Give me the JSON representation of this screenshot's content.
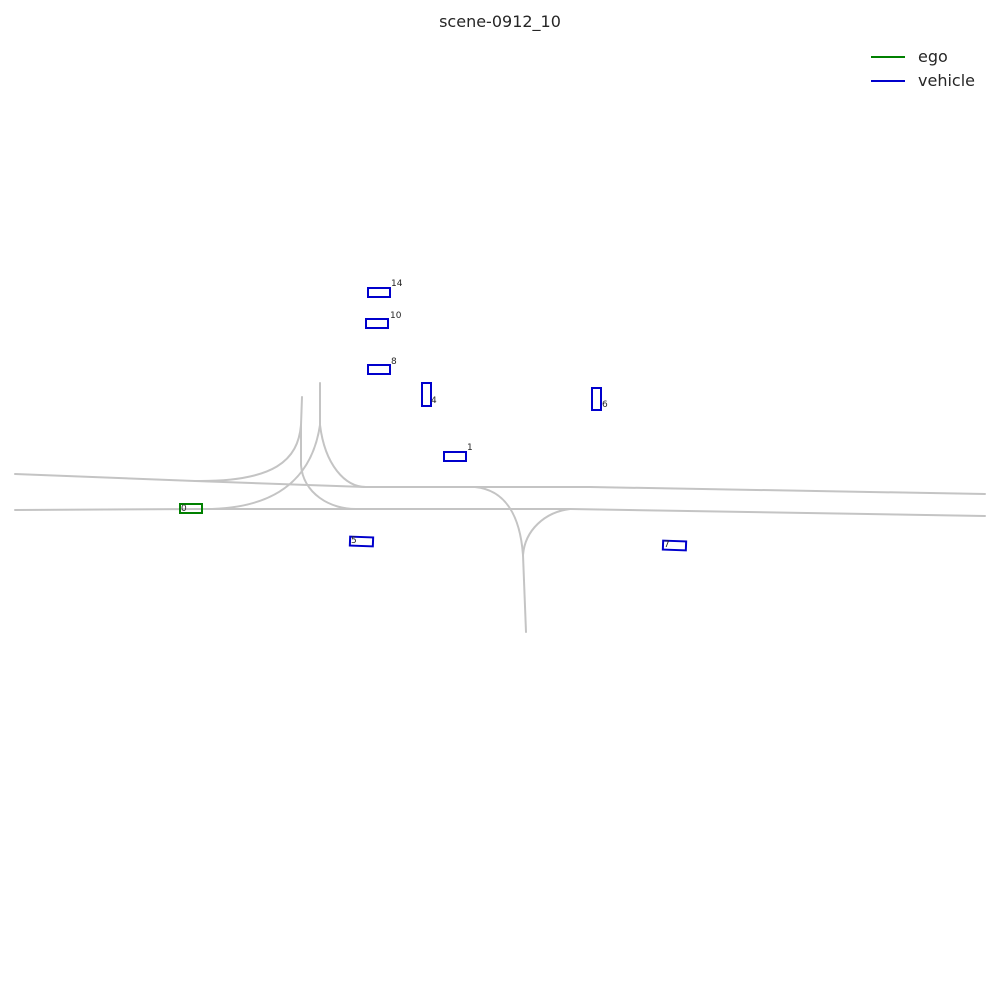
{
  "title": "scene-0912_10",
  "colors": {
    "ego": "#008000",
    "vehicle": "#0000cc",
    "lane": "#c4c4c4"
  },
  "legend": [
    {
      "label": "ego",
      "type": "ego"
    },
    {
      "label": "vehicle",
      "type": "vehicle"
    }
  ],
  "agents": [
    {
      "id": "0",
      "type": "ego"
    },
    {
      "id": "1",
      "type": "vehicle"
    },
    {
      "id": "4",
      "type": "vehicle"
    },
    {
      "id": "5",
      "type": "vehicle"
    },
    {
      "id": "6",
      "type": "vehicle"
    },
    {
      "id": "7",
      "type": "vehicle"
    },
    {
      "id": "8",
      "type": "vehicle"
    },
    {
      "id": "10",
      "type": "vehicle"
    },
    {
      "id": "14",
      "type": "vehicle"
    }
  ]
}
